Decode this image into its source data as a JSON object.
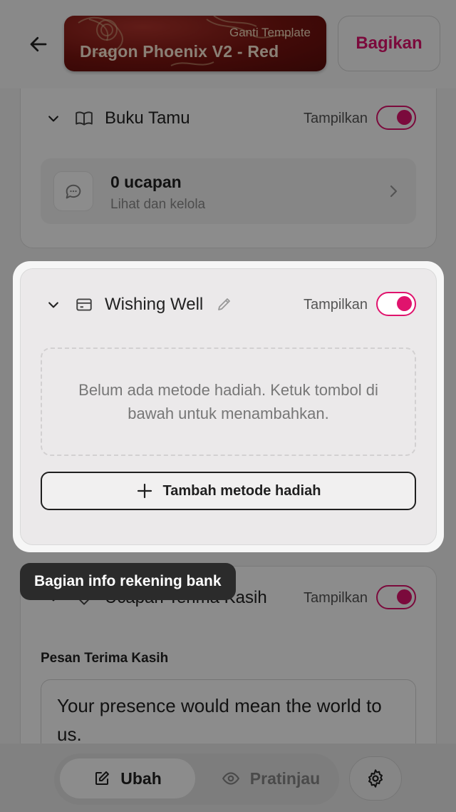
{
  "header": {
    "template_small": "Ganti Template",
    "template_name": "Dragon Phoenix V2 - Red",
    "share_label": "Bagikan"
  },
  "sections": {
    "guestbook": {
      "title": "Buku Tamu",
      "show_label": "Tampilkan",
      "count": "0 ucapan",
      "sub": "Lihat dan kelola"
    },
    "wishing_well": {
      "title": "Wishing Well",
      "show_label": "Tampilkan",
      "empty_text": "Belum ada metode hadiah. Ketuk tombol di bawah untuk menambahkan.",
      "add_label": "Tambah metode hadiah"
    },
    "thanks": {
      "title": "Ucapan Terima Kasih",
      "show_label": "Tampilkan",
      "message_label": "Pesan Terima Kasih",
      "message_value": "Your presence would mean the world to us."
    }
  },
  "tooltip": "Bagian info rekening bank",
  "bottom_bar": {
    "edit_label": "Ubah",
    "preview_label": "Pratinjau"
  },
  "colors": {
    "accent": "#e0136d",
    "template_bg": "#7a1410"
  }
}
